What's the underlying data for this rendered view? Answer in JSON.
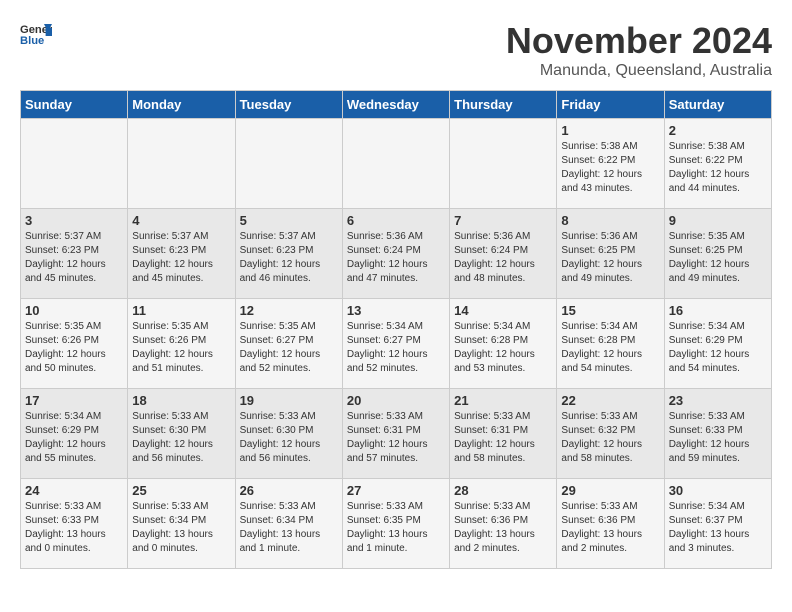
{
  "header": {
    "logo_general": "General",
    "logo_blue": "Blue",
    "month_title": "November 2024",
    "subtitle": "Manunda, Queensland, Australia"
  },
  "weekdays": [
    "Sunday",
    "Monday",
    "Tuesday",
    "Wednesday",
    "Thursday",
    "Friday",
    "Saturday"
  ],
  "weeks": [
    [
      {
        "day": "",
        "info": ""
      },
      {
        "day": "",
        "info": ""
      },
      {
        "day": "",
        "info": ""
      },
      {
        "day": "",
        "info": ""
      },
      {
        "day": "",
        "info": ""
      },
      {
        "day": "1",
        "info": "Sunrise: 5:38 AM\nSunset: 6:22 PM\nDaylight: 12 hours\nand 43 minutes."
      },
      {
        "day": "2",
        "info": "Sunrise: 5:38 AM\nSunset: 6:22 PM\nDaylight: 12 hours\nand 44 minutes."
      }
    ],
    [
      {
        "day": "3",
        "info": "Sunrise: 5:37 AM\nSunset: 6:23 PM\nDaylight: 12 hours\nand 45 minutes."
      },
      {
        "day": "4",
        "info": "Sunrise: 5:37 AM\nSunset: 6:23 PM\nDaylight: 12 hours\nand 45 minutes."
      },
      {
        "day": "5",
        "info": "Sunrise: 5:37 AM\nSunset: 6:23 PM\nDaylight: 12 hours\nand 46 minutes."
      },
      {
        "day": "6",
        "info": "Sunrise: 5:36 AM\nSunset: 6:24 PM\nDaylight: 12 hours\nand 47 minutes."
      },
      {
        "day": "7",
        "info": "Sunrise: 5:36 AM\nSunset: 6:24 PM\nDaylight: 12 hours\nand 48 minutes."
      },
      {
        "day": "8",
        "info": "Sunrise: 5:36 AM\nSunset: 6:25 PM\nDaylight: 12 hours\nand 49 minutes."
      },
      {
        "day": "9",
        "info": "Sunrise: 5:35 AM\nSunset: 6:25 PM\nDaylight: 12 hours\nand 49 minutes."
      }
    ],
    [
      {
        "day": "10",
        "info": "Sunrise: 5:35 AM\nSunset: 6:26 PM\nDaylight: 12 hours\nand 50 minutes."
      },
      {
        "day": "11",
        "info": "Sunrise: 5:35 AM\nSunset: 6:26 PM\nDaylight: 12 hours\nand 51 minutes."
      },
      {
        "day": "12",
        "info": "Sunrise: 5:35 AM\nSunset: 6:27 PM\nDaylight: 12 hours\nand 52 minutes."
      },
      {
        "day": "13",
        "info": "Sunrise: 5:34 AM\nSunset: 6:27 PM\nDaylight: 12 hours\nand 52 minutes."
      },
      {
        "day": "14",
        "info": "Sunrise: 5:34 AM\nSunset: 6:28 PM\nDaylight: 12 hours\nand 53 minutes."
      },
      {
        "day": "15",
        "info": "Sunrise: 5:34 AM\nSunset: 6:28 PM\nDaylight: 12 hours\nand 54 minutes."
      },
      {
        "day": "16",
        "info": "Sunrise: 5:34 AM\nSunset: 6:29 PM\nDaylight: 12 hours\nand 54 minutes."
      }
    ],
    [
      {
        "day": "17",
        "info": "Sunrise: 5:34 AM\nSunset: 6:29 PM\nDaylight: 12 hours\nand 55 minutes."
      },
      {
        "day": "18",
        "info": "Sunrise: 5:33 AM\nSunset: 6:30 PM\nDaylight: 12 hours\nand 56 minutes."
      },
      {
        "day": "19",
        "info": "Sunrise: 5:33 AM\nSunset: 6:30 PM\nDaylight: 12 hours\nand 56 minutes."
      },
      {
        "day": "20",
        "info": "Sunrise: 5:33 AM\nSunset: 6:31 PM\nDaylight: 12 hours\nand 57 minutes."
      },
      {
        "day": "21",
        "info": "Sunrise: 5:33 AM\nSunset: 6:31 PM\nDaylight: 12 hours\nand 58 minutes."
      },
      {
        "day": "22",
        "info": "Sunrise: 5:33 AM\nSunset: 6:32 PM\nDaylight: 12 hours\nand 58 minutes."
      },
      {
        "day": "23",
        "info": "Sunrise: 5:33 AM\nSunset: 6:33 PM\nDaylight: 12 hours\nand 59 minutes."
      }
    ],
    [
      {
        "day": "24",
        "info": "Sunrise: 5:33 AM\nSunset: 6:33 PM\nDaylight: 13 hours\nand 0 minutes."
      },
      {
        "day": "25",
        "info": "Sunrise: 5:33 AM\nSunset: 6:34 PM\nDaylight: 13 hours\nand 0 minutes."
      },
      {
        "day": "26",
        "info": "Sunrise: 5:33 AM\nSunset: 6:34 PM\nDaylight: 13 hours\nand 1 minute."
      },
      {
        "day": "27",
        "info": "Sunrise: 5:33 AM\nSunset: 6:35 PM\nDaylight: 13 hours\nand 1 minute."
      },
      {
        "day": "28",
        "info": "Sunrise: 5:33 AM\nSunset: 6:36 PM\nDaylight: 13 hours\nand 2 minutes."
      },
      {
        "day": "29",
        "info": "Sunrise: 5:33 AM\nSunset: 6:36 PM\nDaylight: 13 hours\nand 2 minutes."
      },
      {
        "day": "30",
        "info": "Sunrise: 5:34 AM\nSunset: 6:37 PM\nDaylight: 13 hours\nand 3 minutes."
      }
    ]
  ]
}
